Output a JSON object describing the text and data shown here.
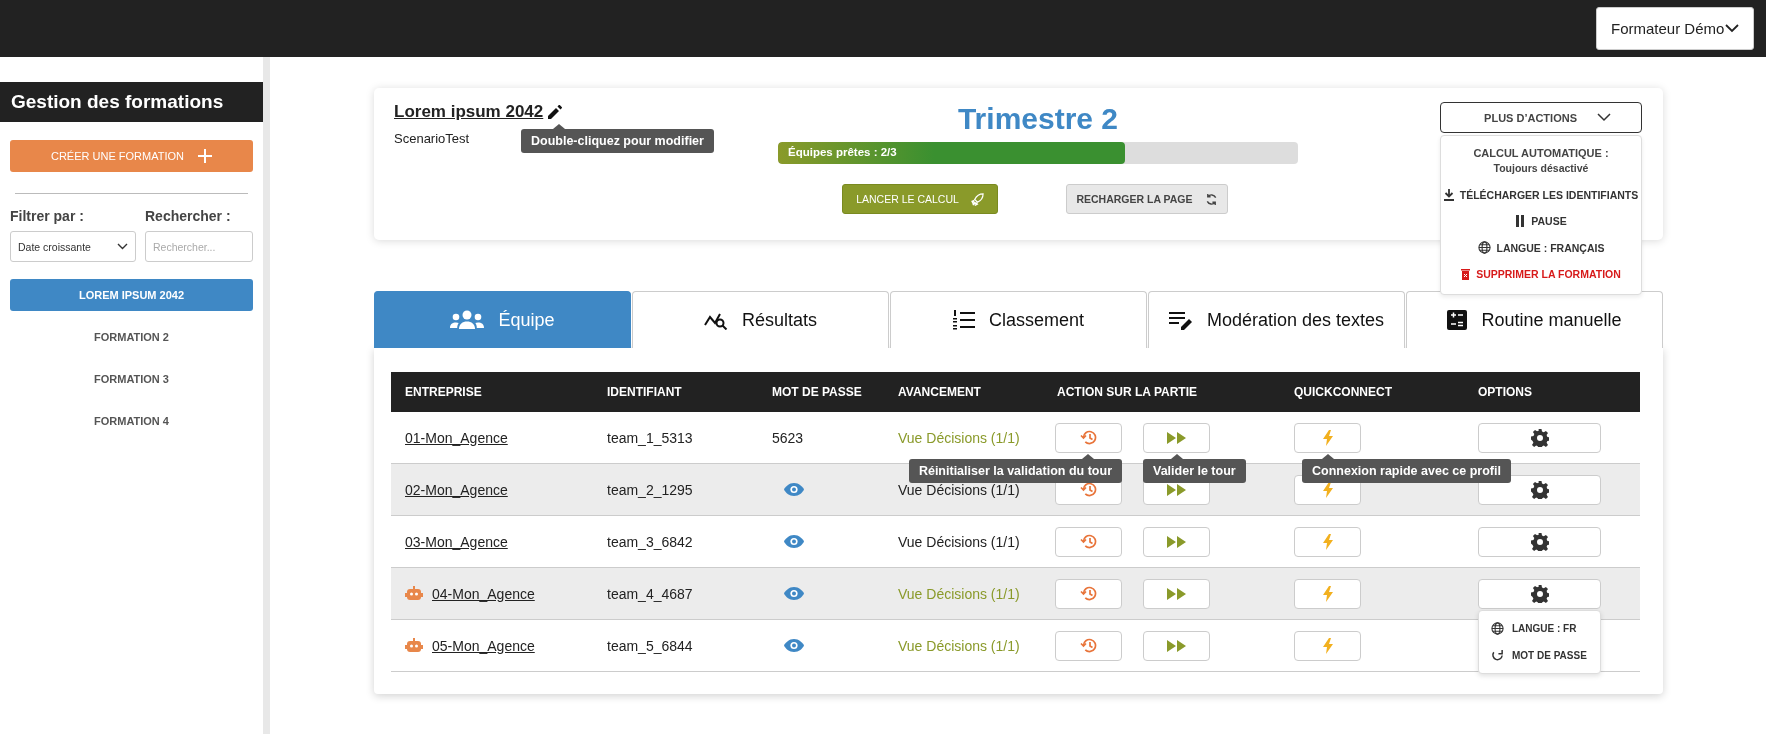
{
  "top_bar": {
    "user_menu": "Formateur Démo"
  },
  "sidebar": {
    "title": "Gestion des formations",
    "create_button": "CRÉER UNE FORMATION",
    "filter": {
      "label": "Filtrer par :",
      "value": "Date croissante"
    },
    "search": {
      "label": "Rechercher :",
      "placeholder": "Rechercher..."
    },
    "items": [
      {
        "label": "LOREM IPSUM 2042",
        "selected": true
      },
      {
        "label": "FORMATION 2",
        "selected": false
      },
      {
        "label": "FORMATION 3",
        "selected": false
      },
      {
        "label": "FORMATION 4",
        "selected": false
      }
    ]
  },
  "header": {
    "title": "Lorem ipsum 2042",
    "title_tooltip": "Double-cliquez pour modifier",
    "scenario": "ScenarioTest",
    "period": "Trimestre 2",
    "progress": {
      "label": "Équipes prêtes : 2/3",
      "level": 0.667
    },
    "run_button": "LANCER LE CALCUL",
    "reload_button": "RECHARGER LA PAGE",
    "more_actions": {
      "label": "PLUS D’ACTIONS",
      "expanded": true,
      "items": [
        {
          "kind": "info",
          "label": "CALCUL AUTOMATIQUE :",
          "detail": "Toujours désactivé"
        },
        {
          "kind": "download",
          "label": "TÉLÉCHARGER LES IDENTIFIANTS"
        },
        {
          "kind": "pause",
          "label": "PAUSE"
        },
        {
          "kind": "language",
          "label": "LANGUE : FRANÇAIS"
        },
        {
          "kind": "delete",
          "label": "SUPPRIMER LA FORMATION"
        }
      ]
    }
  },
  "tabs": [
    {
      "kind": "team",
      "label": "Équipe",
      "selected": true
    },
    {
      "kind": "results",
      "label": "Résultats",
      "selected": false
    },
    {
      "kind": "ranking",
      "label": "Classement",
      "selected": false
    },
    {
      "kind": "moderation",
      "label": "Modération des textes",
      "selected": false
    },
    {
      "kind": "routine",
      "label": "Routine manuelle",
      "selected": false
    }
  ],
  "table": {
    "columns": [
      "ENTREPRISE",
      "IDENTIFIANT",
      "MOT DE PASSE",
      "AVANCEMENT",
      "ACTION SUR LA PARTIE",
      "QUICKCONNECT",
      "OPTIONS"
    ],
    "rows": [
      {
        "company": "01-Mon_Agence",
        "bot": false,
        "login": "team_1_5313",
        "password": {
          "kind": "shown",
          "text": "5623"
        },
        "progress": {
          "text": "Vue Décisions (1/1)",
          "color": "#8a9a2a"
        },
        "tooltips": [
          "Réinitialiser la validation du tour",
          "Valider le tour",
          "Connexion rapide avec ce profil"
        ]
      },
      {
        "company": "02-Mon_Agence",
        "bot": false,
        "login": "team_2_1295",
        "password": {
          "kind": "hidden"
        },
        "progress": {
          "text": "Vue Décisions (1/1)",
          "color": "#222222"
        }
      },
      {
        "company": "03-Mon_Agence",
        "bot": false,
        "login": "team_3_6842",
        "password": {
          "kind": "hidden"
        },
        "progress": {
          "text": "Vue Décisions (1/1)",
          "color": "#222222"
        }
      },
      {
        "company": "04-Mon_Agence",
        "bot": true,
        "login": "team_4_4687",
        "password": {
          "kind": "hidden"
        },
        "progress": {
          "text": "Vue Décisions (1/1)",
          "color": "#8a9a2a"
        },
        "options_menu": [
          {
            "kind": "language",
            "label": "LANGUE : FR"
          },
          {
            "kind": "password",
            "label": "MOT DE PASSE"
          }
        ]
      },
      {
        "company": "05-Mon_Agence",
        "bot": true,
        "login": "team_5_6844",
        "password": {
          "kind": "hidden"
        },
        "progress": {
          "text": "Vue Décisions (1/1)",
          "color": "#8a9a2a"
        }
      }
    ]
  }
}
